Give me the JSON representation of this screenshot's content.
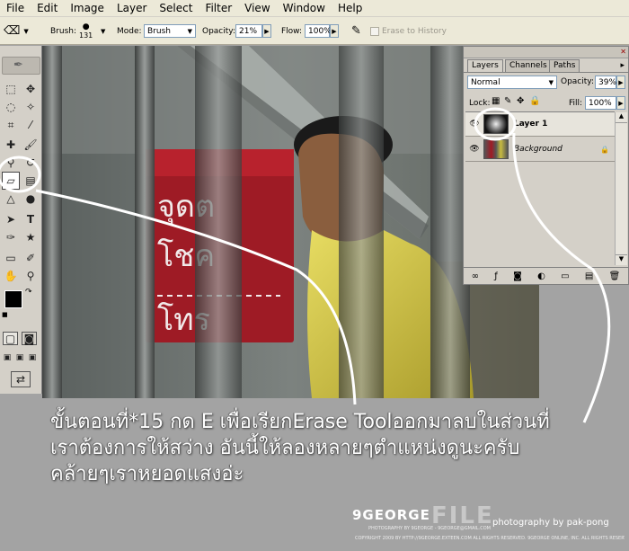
{
  "menu": [
    "File",
    "Edit",
    "Image",
    "Layer",
    "Select",
    "Filter",
    "View",
    "Window",
    "Help"
  ],
  "options": {
    "brush_label": "Brush:",
    "brush_size": "131",
    "mode_label": "Mode:",
    "mode_value": "Brush",
    "opacity_label": "Opacity:",
    "opacity_value": "21%",
    "flow_label": "Flow:",
    "flow_value": "100%",
    "erase_history": "Erase to History"
  },
  "photo_sign": {
    "line1": "จุดต",
    "line2": "โชค",
    "line3": "โทร"
  },
  "layers_panel": {
    "tabs": [
      "Layers",
      "Channels",
      "Paths"
    ],
    "blend_mode": "Normal",
    "opacity_label": "Opacity:",
    "opacity_value": "39%",
    "lock_label": "Lock:",
    "fill_label": "Fill:",
    "fill_value": "100%",
    "layers": [
      {
        "name": "Layer 1"
      },
      {
        "name": "Background"
      }
    ]
  },
  "caption": {
    "line1": "ขั้นตอนที่*15 กด E เพื่อเรียกErase Toolออกมาลบในส่วนที่",
    "line2": "เราต้องการให้สว่าง อันนี้ให้ลองหลายๆตำแหน่งดูนะครับ",
    "line3": "คล้ายๆเราหยอดแสงอ่ะ"
  },
  "watermark": {
    "brand": "9GEORGE",
    "file": "FILE",
    "photography": "photography by pak-pong",
    "small1": "PHOTOGRAPHY BY 9GEORGE - 9GEORGE@GMAIL.COM",
    "small2": "COPYRIGHT 2009 BY HTTP://9GEORGE.EXTEEN.COM ALL RIGHTS RESERVED. 9GEORGE ONLINE, INC. ALL RIGHTS RESERVED."
  },
  "colors": {
    "ui_bg": "#d4d0c8",
    "menubar_bg": "#ece9d8",
    "page_bg": "#a3a3a3",
    "sign_red": "#a01a24",
    "shirt_yellow": "#d6c84a"
  }
}
